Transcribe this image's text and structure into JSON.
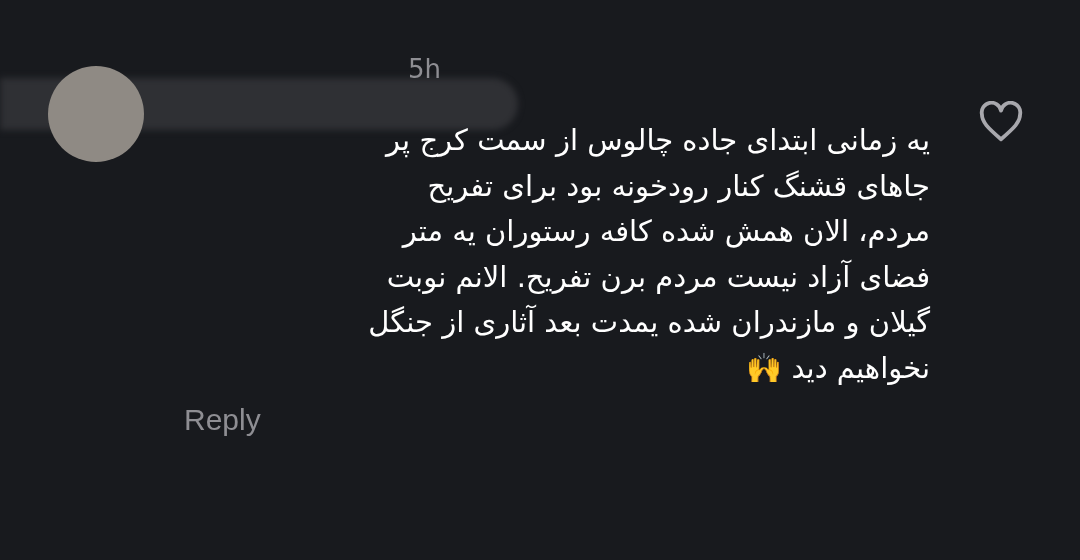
{
  "comment": {
    "time": "5h",
    "text": "یه زمانی ابتدای جاده چالوس از سمت کرج پر\nجاهای قشنگ کنار رودخونه بود برای تفریح\nمردم، الان همش شده کافه رستوران یه متر\nفضای آزاد نیست مردم برن تفریح. الانم نوبت\nگیلان و مازندران شده یمدت بعد آثاری از جنگل\nنخواهیم دید 🙌",
    "reply": "Reply",
    "liked": false
  }
}
